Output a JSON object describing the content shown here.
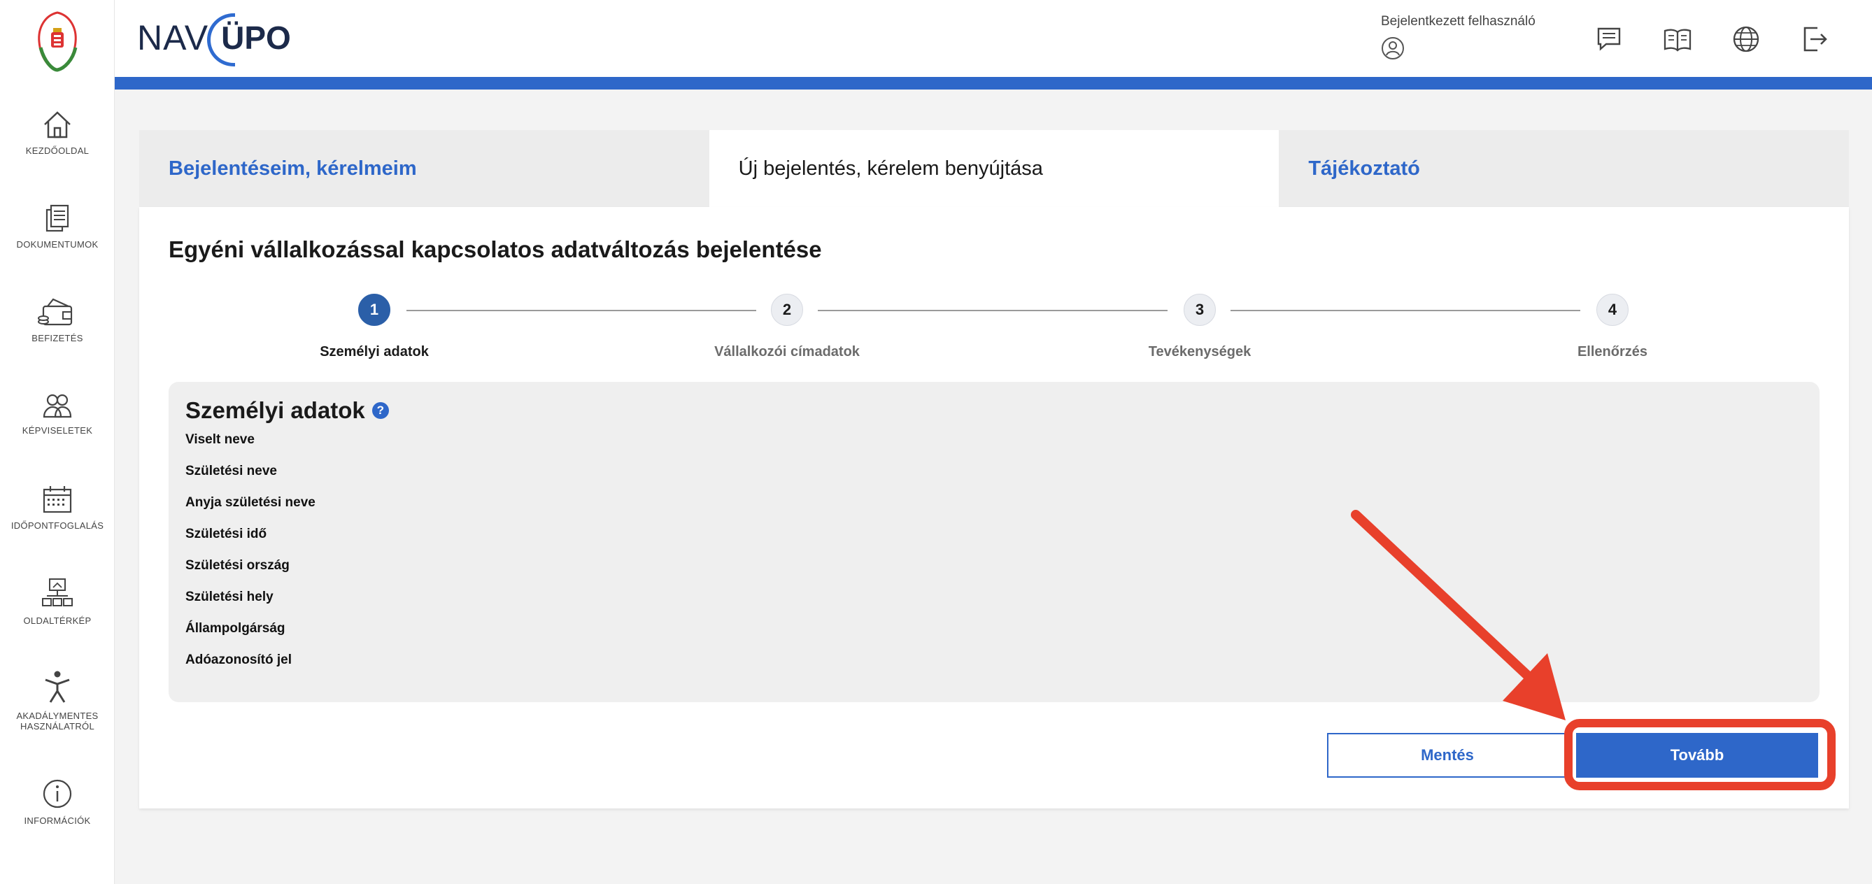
{
  "sidebar": {
    "items": [
      {
        "label": "KEZDŐOLDAL",
        "icon": "home-icon"
      },
      {
        "label": "DOKUMENTUMOK",
        "icon": "documents-icon"
      },
      {
        "label": "BEFIZETÉS",
        "icon": "wallet-icon"
      },
      {
        "label": "KÉPVISELETEK",
        "icon": "users-icon"
      },
      {
        "label": "IDŐPONTFOGLALÁS",
        "icon": "calendar-icon"
      },
      {
        "label": "OLDALTÉRKÉP",
        "icon": "sitemap-icon"
      },
      {
        "label": "AKADÁLYMENTES HASZNÁLATRÓL",
        "icon": "accessibility-icon"
      },
      {
        "label": "INFORMÁCIÓK",
        "icon": "info-icon"
      }
    ]
  },
  "header": {
    "brand_nav": "NAV",
    "brand_upo": "ÜPO",
    "user_label": "Bejelentkezett felhasználó",
    "icons": [
      "message-icon",
      "book-icon",
      "globe-icon",
      "logout-icon"
    ]
  },
  "tabs": [
    {
      "label": "Bejelentéseim, kérelmeim",
      "active": false
    },
    {
      "label": "Új bejelentés, kérelem benyújtása",
      "active": true
    },
    {
      "label": "Tájékoztató",
      "active": false
    }
  ],
  "main": {
    "title": "Egyéni vállalkozással kapcsolatos adatváltozás bejelentése"
  },
  "stepper": {
    "steps": [
      {
        "number": "1",
        "label": "Személyi adatok",
        "active": true
      },
      {
        "number": "2",
        "label": "Vállalkozói címadatok",
        "active": false
      },
      {
        "number": "3",
        "label": "Tevékenységek",
        "active": false
      },
      {
        "number": "4",
        "label": "Ellenőrzés",
        "active": false
      }
    ]
  },
  "panel": {
    "title": "Személyi adatok",
    "help": "?",
    "fields": [
      "Viselt neve",
      "Születési neve",
      "Anyja születési neve",
      "Születési idő",
      "Születési ország",
      "Születési hely",
      "Állampolgárság",
      "Adóazonosító jel"
    ]
  },
  "actions": {
    "save_label": "Mentés",
    "next_label": "Tovább"
  },
  "colors": {
    "accent": "#2e67c9",
    "annotation": "#e8402b",
    "stepper_active": "#2b5fa8"
  }
}
